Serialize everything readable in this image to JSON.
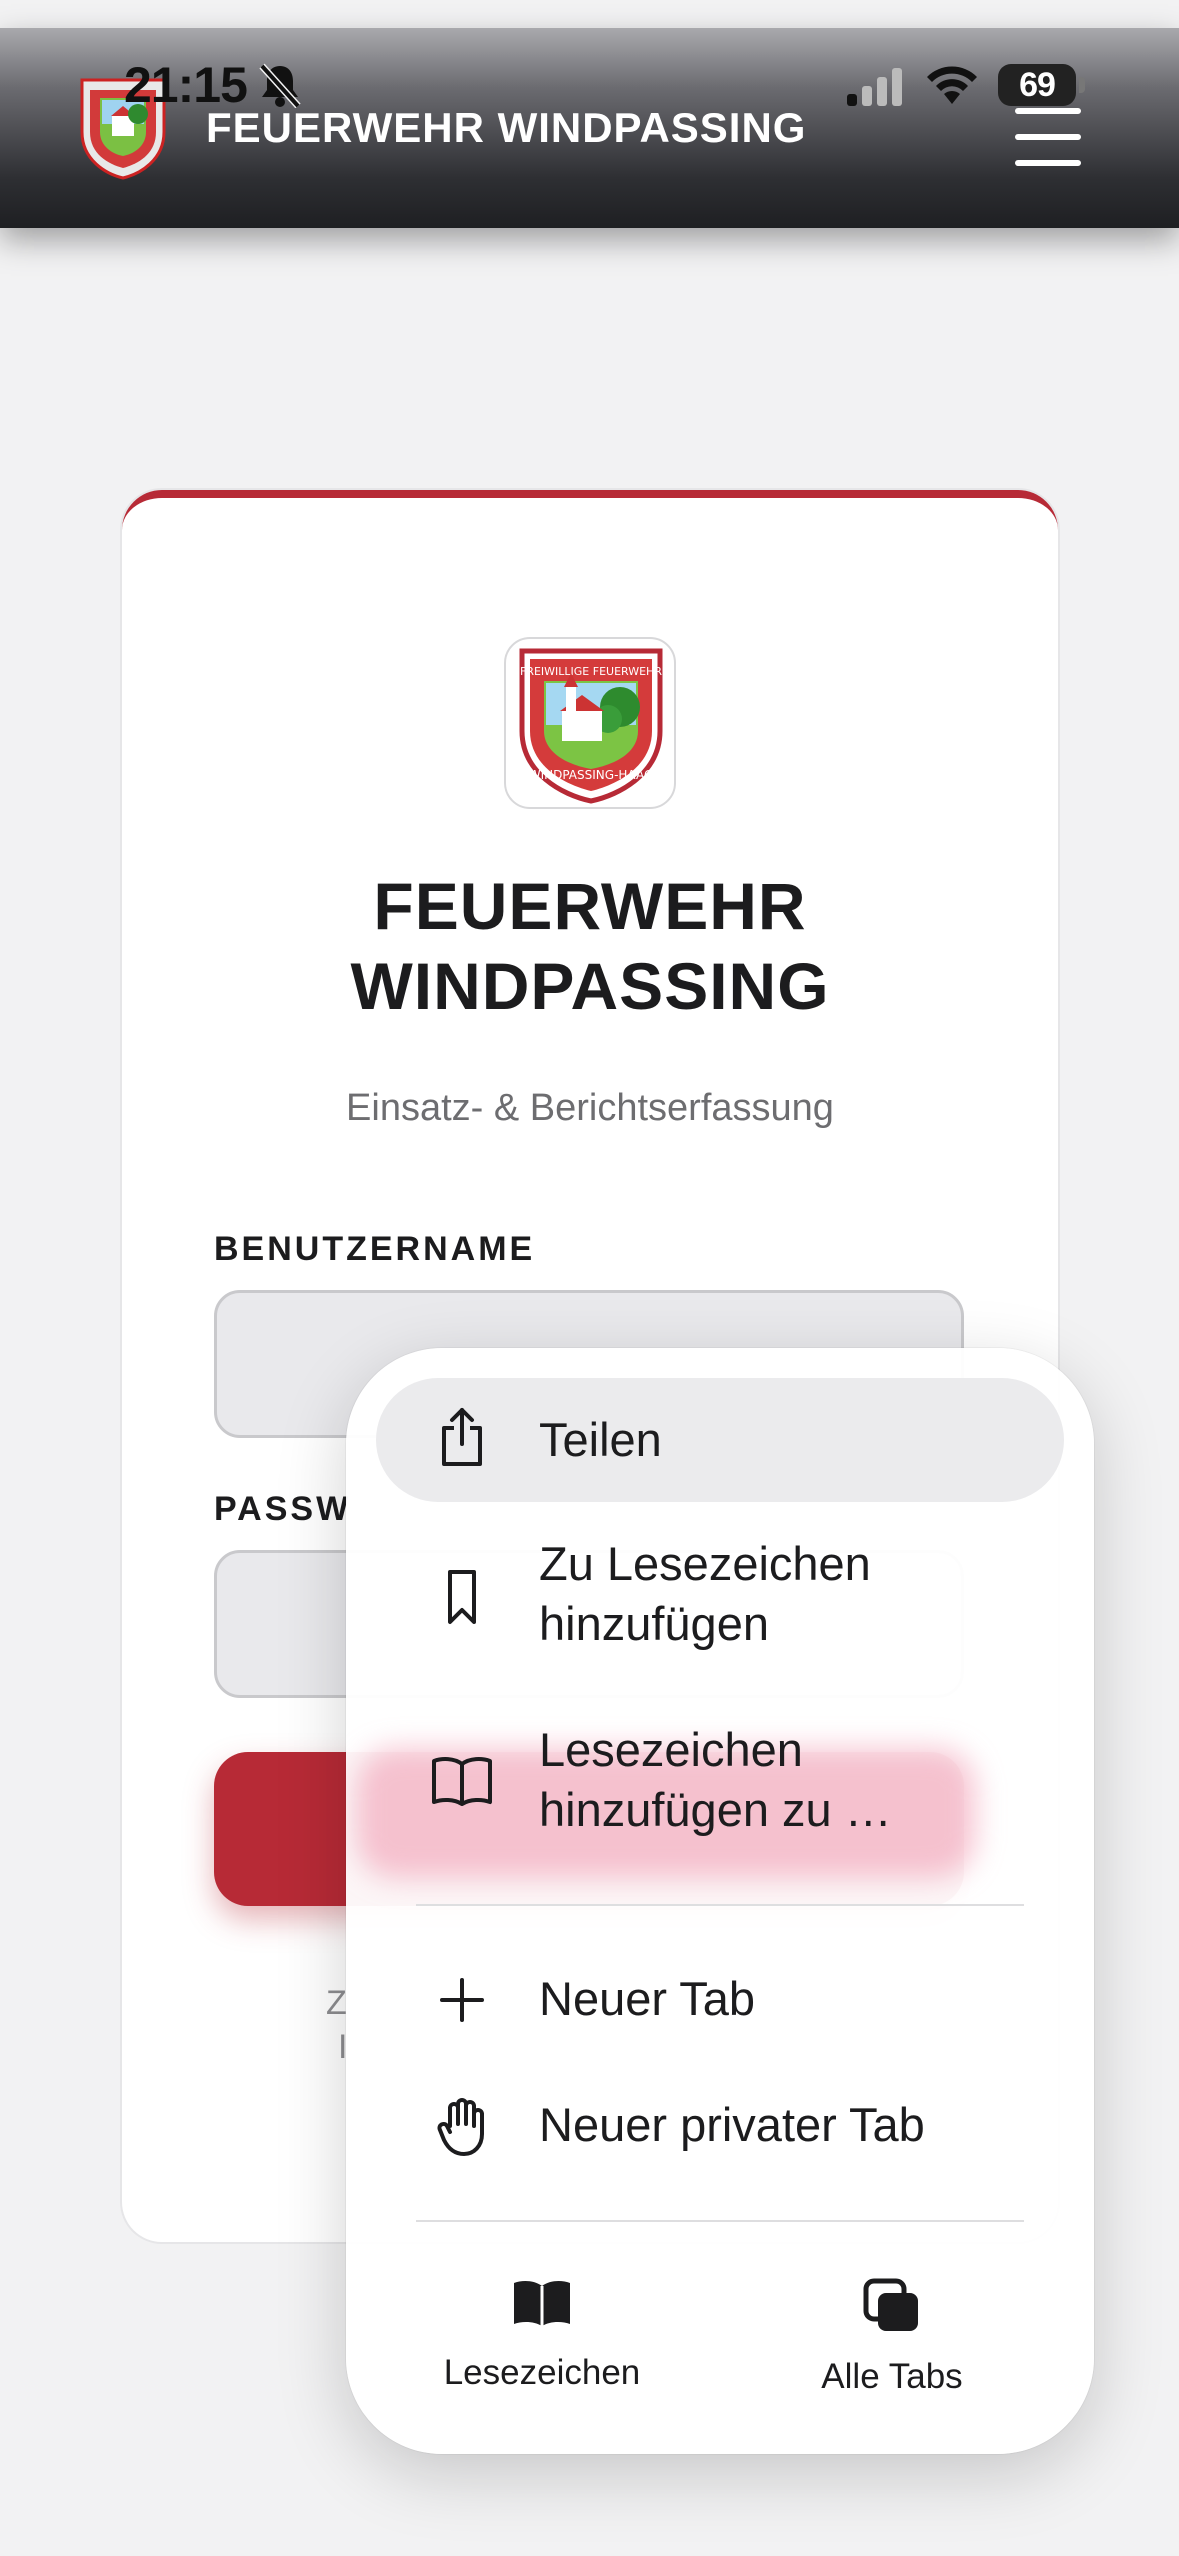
{
  "status_bar": {
    "time": "21:15",
    "battery": "69"
  },
  "header": {
    "title": "FEUERWEHR WINDPASSING"
  },
  "crest": {
    "top_text": "FREIWILLIGE FEUERWEHR",
    "bottom_text": "WINDPASSING-HAAG"
  },
  "login": {
    "title_line1": "FEUERWEHR",
    "title_line2": "WINDPASSING",
    "subtitle": "Einsatz- & Berichtserfassung",
    "username_label": "BENUTZERNAME",
    "password_label_visible": "PASSW",
    "footer_line1_visible": "Z",
    "footer_line2_visible": "I"
  },
  "context_menu": {
    "items": [
      {
        "label": "Teilen",
        "icon": "share-icon"
      },
      {
        "label_line1": "Zu Lesezeichen",
        "label_line2": "hinzufügen",
        "icon": "bookmark-icon"
      },
      {
        "label_line1": "Lesezeichen",
        "label_line2": "hinzufügen zu …",
        "icon": "book-open-icon"
      },
      {
        "label": "Neuer Tab",
        "icon": "plus-icon"
      },
      {
        "label": "Neuer privater Tab",
        "icon": "hand-icon"
      }
    ],
    "bottom": [
      {
        "label": "Lesezeichen",
        "icon": "book-icon"
      },
      {
        "label": "Alle Tabs",
        "icon": "tabs-icon"
      }
    ]
  },
  "colors": {
    "accent": "#b72a36",
    "header_dark": "#1e1f22",
    "background": "#f2f2f3"
  }
}
